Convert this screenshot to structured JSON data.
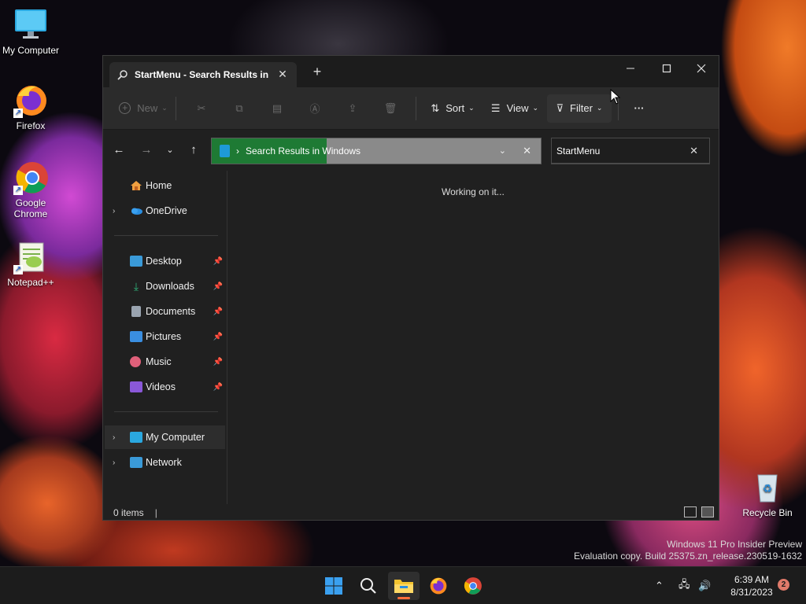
{
  "desktop": {
    "icons": [
      {
        "label": "My Computer"
      },
      {
        "label": "Firefox"
      },
      {
        "label": "Google Chrome"
      },
      {
        "label": "Notepad++"
      },
      {
        "label": "Recycle Bin"
      }
    ],
    "watermark_line1": "Windows 11 Pro Insider Preview",
    "watermark_line2": "Evaluation copy. Build 25375.zn_release.230519-1632"
  },
  "explorer": {
    "tab_title": "StartMenu - Search Results in",
    "window_controls": {
      "minimize": "—",
      "maximize": "☐",
      "close": "✕"
    },
    "toolbar": {
      "new_label": "New",
      "sort_label": "Sort",
      "view_label": "View",
      "filter_label": "Filter",
      "more_label": "···"
    },
    "address": {
      "path": "Search Results in Windows",
      "search_progress": 0.35
    },
    "search": {
      "value": "StartMenu"
    },
    "nav": {
      "home": "Home",
      "onedrive": "OneDrive",
      "quick_access": [
        {
          "label": "Desktop",
          "icon": "desktop-icon",
          "color": "#3a9ad8"
        },
        {
          "label": "Downloads",
          "icon": "download-icon",
          "color": "#2fb37a"
        },
        {
          "label": "Documents",
          "icon": "document-icon",
          "color": "#9aa4b0"
        },
        {
          "label": "Pictures",
          "icon": "pictures-icon",
          "color": "#3a8ee0"
        },
        {
          "label": "Music",
          "icon": "music-icon",
          "color": "#e0607a"
        },
        {
          "label": "Videos",
          "icon": "videos-icon",
          "color": "#8a58d8"
        }
      ],
      "my_computer": "My Computer",
      "network": "Network"
    },
    "content_status": "Working on it...",
    "status_bar": {
      "items_count": "0 items"
    }
  },
  "taskbar": {
    "time": "6:39 AM",
    "date": "8/31/2023",
    "notification_count": "2",
    "accent_color": "#ff6d3a"
  }
}
